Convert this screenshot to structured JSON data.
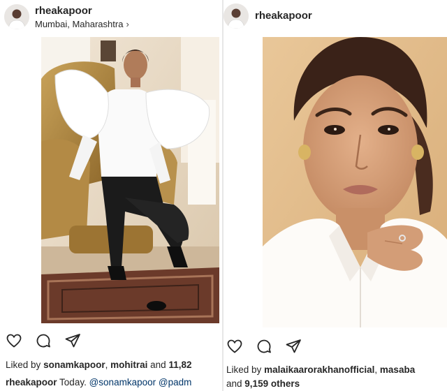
{
  "left_post": {
    "username": "rheakapoor",
    "location": "Mumbai, Maharashtra",
    "location_chevron": "›",
    "liked_prefix": "Liked by",
    "liked_user_1": "sonamkapoor",
    "liked_sep": ",",
    "liked_user_2": "mohitrai",
    "liked_and": "and",
    "liked_count": "11,82",
    "caption_user": "rheakapoor",
    "caption_text": "Today.",
    "caption_mention_1": "@sonamkapoor",
    "caption_mention_2": "@padm",
    "icons": {
      "like": "heart-icon",
      "comment": "comment-icon",
      "share": "paper-plane-icon"
    }
  },
  "right_post": {
    "username": "rheakapoor",
    "liked_prefix": "Liked by",
    "liked_user_1": "malaikaarorakhanofficial",
    "liked_sep": ",",
    "liked_user_2": "masaba",
    "and_text": "and",
    "others_text": "9,159 others",
    "icons": {
      "like": "heart-icon",
      "comment": "comment-icon",
      "share": "paper-plane-icon"
    }
  },
  "colors": {
    "text": "#262626",
    "mention": "#003569",
    "background": "#ffffff"
  }
}
